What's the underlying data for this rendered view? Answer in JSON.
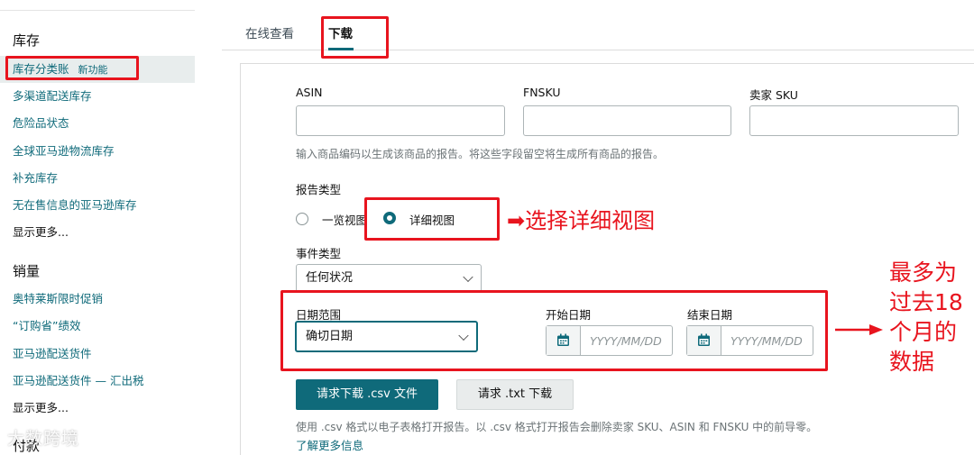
{
  "sidebar": {
    "sections": [
      {
        "title": "库存",
        "items": [
          {
            "label": "库存分类账",
            "badge": "新功能"
          },
          {
            "label": "多渠道配送库存"
          },
          {
            "label": "危险品状态"
          },
          {
            "label": "全球亚马逊物流库存"
          },
          {
            "label": "补充库存"
          },
          {
            "label": "无在售信息的亚马逊库存"
          }
        ],
        "more": "显示更多..."
      },
      {
        "title": "销量",
        "items": [
          {
            "label": "奥特莱斯限时促销"
          },
          {
            "label": "“订购省”绩效"
          },
          {
            "label": "亚马逊配送货件"
          },
          {
            "label": "亚马逊配送货件 — 汇出税"
          }
        ],
        "more": "显示更多..."
      },
      {
        "title": "付款"
      }
    ]
  },
  "tabs": [
    {
      "label": "在线查看",
      "active": false
    },
    {
      "label": "下载",
      "active": true
    }
  ],
  "form": {
    "asin_label": "ASIN",
    "fnsku_label": "FNSKU",
    "seller_sku_label": "卖家 SKU",
    "id_hint": "输入商品编码以生成该商品的报告。将这些字段留空将生成所有商品的报告。",
    "report_type_label": "报告类型",
    "report_types": [
      {
        "label": "一览视图",
        "selected": false
      },
      {
        "label": "详细视图",
        "selected": true
      }
    ],
    "event_type_label": "事件类型",
    "event_type_value": "任何状况",
    "date_range_label": "日期范围",
    "date_range_value": "确切日期",
    "start_date_label": "开始日期",
    "start_date_placeholder": "YYYY/MM/DD",
    "end_date_label": "结束日期",
    "end_date_placeholder": "YYYY/MM/DD",
    "download_csv_label": "请求下载 .csv 文件",
    "download_txt_label": "请求 .txt 下载",
    "csv_note": "使用 .csv 格式以电子表格打开报告。以 .csv 格式打开报告会删除卖家 SKU、ASIN 和 FNSKU 中的前导零。",
    "learn_more": "了解更多信息"
  },
  "annotations": {
    "select_detail": "➡选择详细视图",
    "max_range_lines": [
      "最多为",
      "过去18",
      "个月的",
      "数据"
    ],
    "color": "#e8141e"
  },
  "watermark": "大数跨境",
  "colors": {
    "accent": "#0f6a7a",
    "annotation": "#e8141e"
  }
}
